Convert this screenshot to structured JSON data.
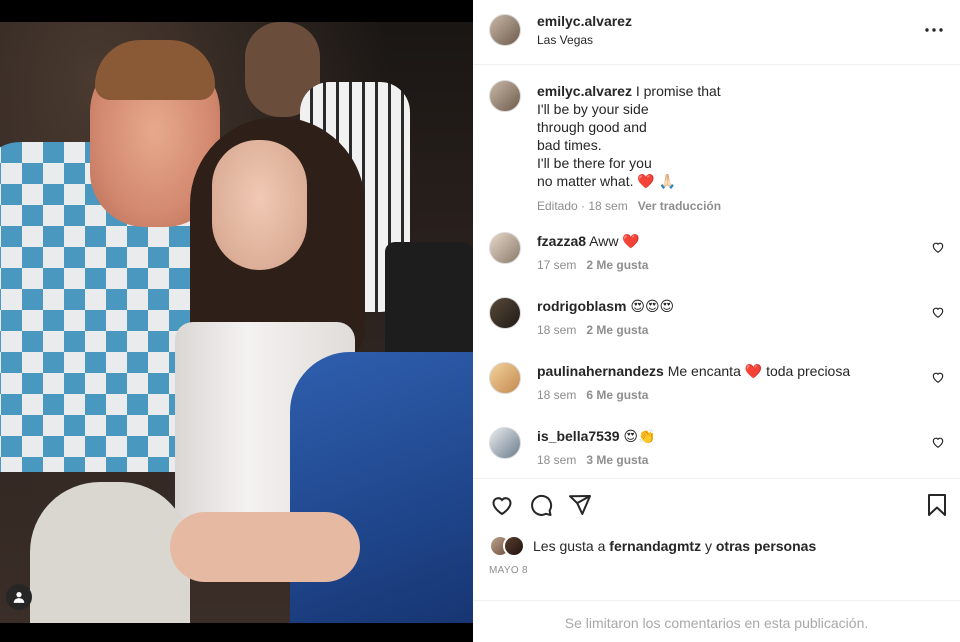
{
  "post": {
    "username": "emilyc.alvarez",
    "location": "Las Vegas"
  },
  "caption": {
    "username": "emilyc.alvarez",
    "lines": [
      "I promise that",
      "I'll be by your side",
      "through good and",
      "bad times.",
      "I'll be there for you",
      "no matter what."
    ],
    "emoji": "❤️ 🙏🏻",
    "edited": "Editado",
    "time": "18 sem",
    "translate": "Ver traducción"
  },
  "comments": [
    {
      "username": "fzazza8",
      "text": "Aww ❤️",
      "time": "17 sem",
      "likes": "2 Me gusta"
    },
    {
      "username": "rodrigoblasm",
      "text": "😍😍😍",
      "time": "18 sem",
      "likes": "2 Me gusta"
    },
    {
      "username": "paulinahernandezs",
      "text": "Me encanta ❤️ toda preciosa",
      "time": "18 sem",
      "likes": "6 Me gusta"
    },
    {
      "username": "is_bella7539",
      "text": "😍👏",
      "time": "18 sem",
      "likes": "3 Me gusta"
    }
  ],
  "likes": {
    "prefix": "Les gusta a",
    "user": "fernandagmtz",
    "connector": "y",
    "others": "otras personas"
  },
  "date": "MAYO 8",
  "comments_limited": "Se limitaron los comentarios en esta publicación.",
  "icons": {
    "more": "more-horizontal-icon",
    "heart": "heart-icon",
    "comment": "comment-icon",
    "share": "share-icon",
    "save": "bookmark-icon",
    "user_tag": "user-tag-icon"
  },
  "colors": {
    "heart_red": "#ed4956",
    "text": "#262626",
    "muted": "#8e8e8e"
  }
}
